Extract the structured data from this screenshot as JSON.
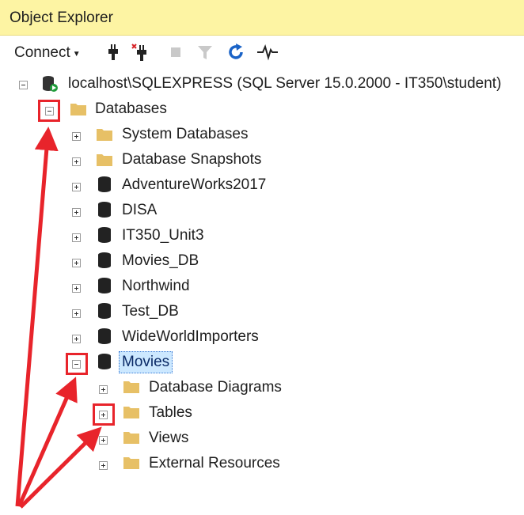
{
  "panel": {
    "title": "Object Explorer"
  },
  "toolbar": {
    "connect_label": "Connect",
    "icons": [
      "connect-plug-icon",
      "disconnect-plug-icon",
      "stop-icon",
      "filter-icon",
      "refresh-icon",
      "activity-monitor-icon"
    ]
  },
  "tree": {
    "server": "localhost\\SQLEXPRESS (SQL Server 15.0.2000 - IT350\\student)",
    "databases_folder": "Databases",
    "folders": [
      "System Databases",
      "Database Snapshots"
    ],
    "databases": [
      "AdventureWorks2017",
      "DISA",
      "IT350_Unit3",
      "Movies_DB",
      "Northwind",
      "Test_DB",
      "WideWorldImporters"
    ],
    "selected_db": "Movies",
    "movies_children": [
      "Database Diagrams",
      "Tables",
      "Views",
      "External Resources"
    ]
  },
  "colors": {
    "title_bar": "#fdf4a3",
    "highlight_box": "#e8242b",
    "arrow": "#e8242b",
    "selection": "#cce8ff",
    "folder": "#e7c066"
  }
}
